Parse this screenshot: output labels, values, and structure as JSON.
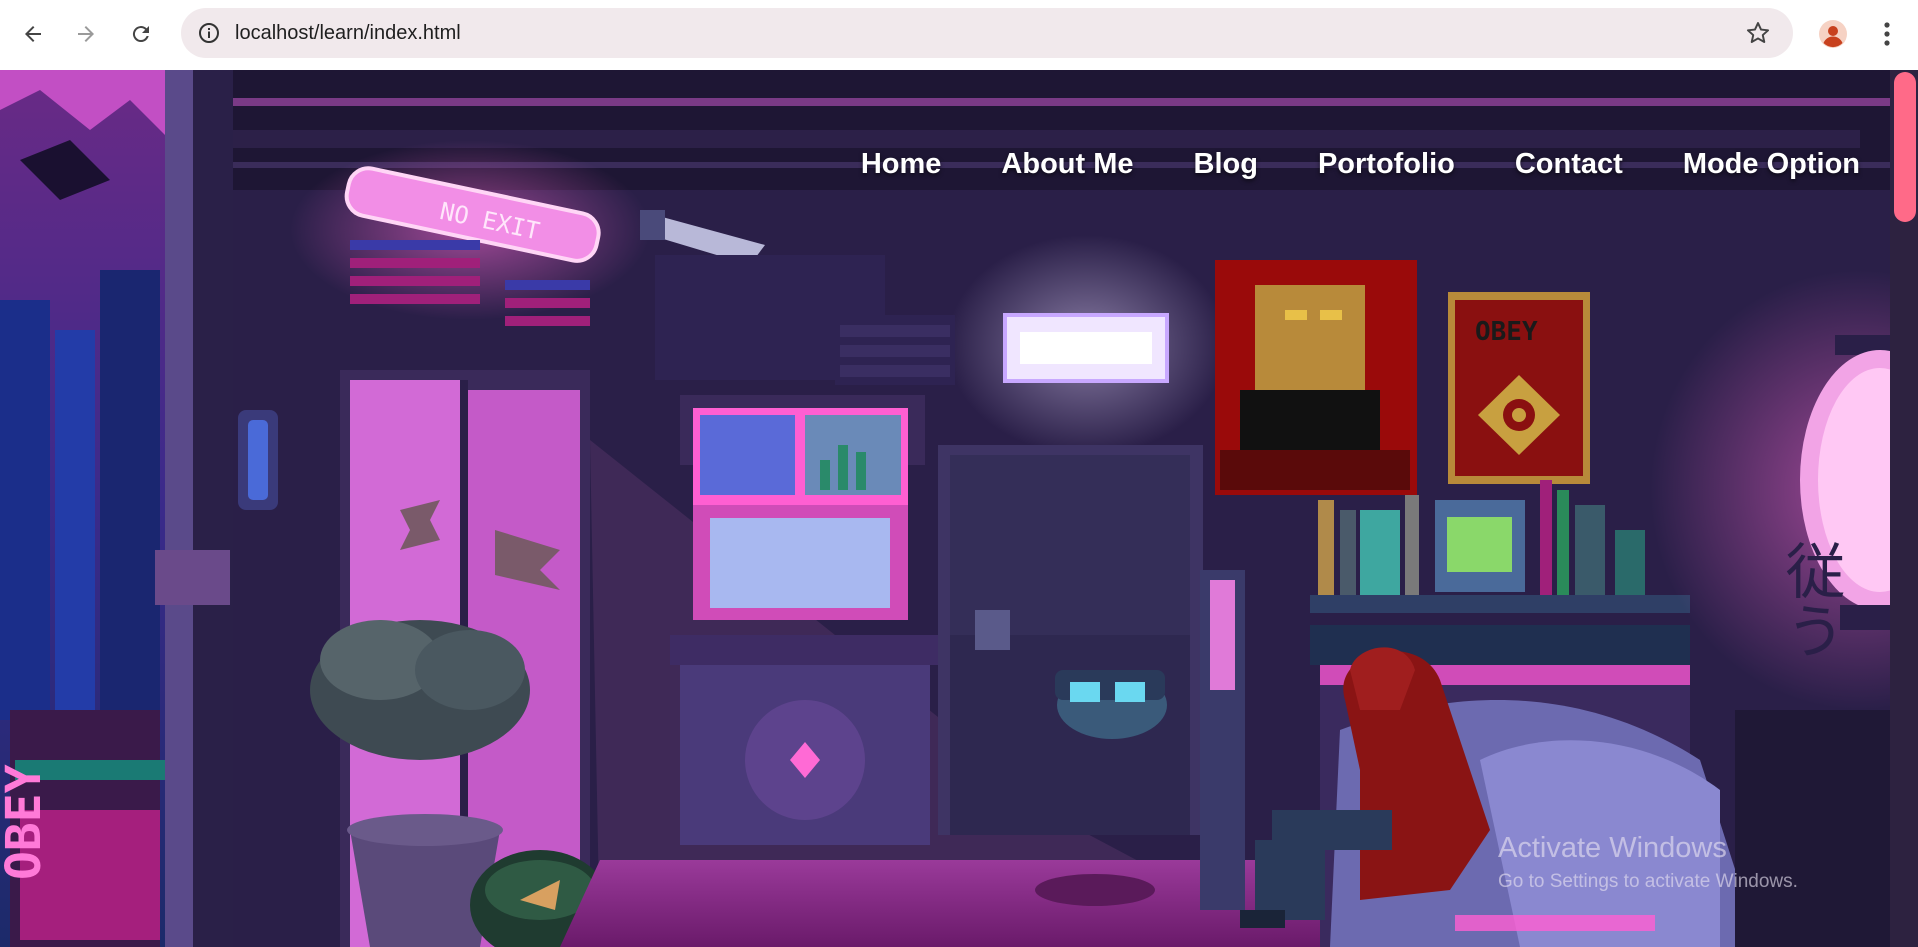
{
  "browser": {
    "url": "localhost/learn/index.html",
    "icons": {
      "back": "arrow-left-icon",
      "forward": "arrow-right-icon",
      "reload": "reload-icon",
      "site_info": "info-icon",
      "bookmark": "star-icon",
      "profile": "person-icon",
      "menu": "kebab-icon"
    }
  },
  "nav": {
    "items": [
      {
        "label": "Home"
      },
      {
        "label": "About Me"
      },
      {
        "label": "Blog"
      },
      {
        "label": "Portofolio"
      },
      {
        "label": "Contact"
      },
      {
        "label": "Mode Option"
      }
    ]
  },
  "scene": {
    "sign_no_exit": "NO EXIT",
    "sign_obey_left": "OBEY",
    "poster_obey": "OBEY",
    "lantern_text": "従う"
  },
  "watermark": {
    "title": "Activate Windows",
    "subtitle": "Go to Settings to activate Windows."
  },
  "colors": {
    "accent_pink": "#ff5fd2",
    "scrollbar_thumb": "#ff6a88",
    "nav_text": "#ffffff"
  }
}
